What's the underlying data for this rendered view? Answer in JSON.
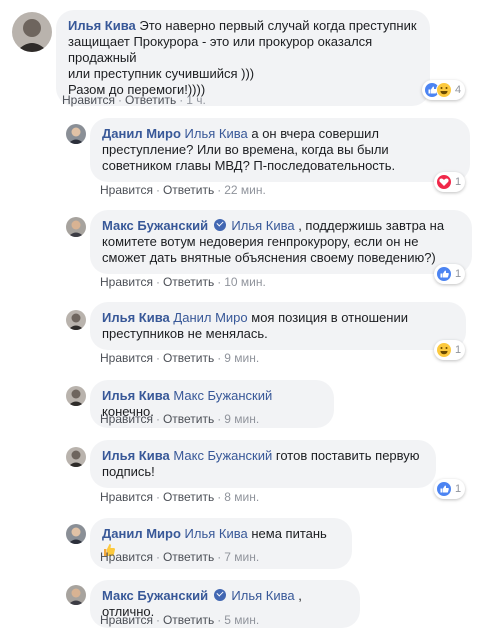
{
  "comments": [
    {
      "author": "Илья Кива",
      "body_lines": [
        "Это наверно первый случай когда преступник",
        "защищает Прокурора - это или прокурор оказался продажный",
        "или преступник сучившийся )))",
        "Разом до перемоги!)))) "
      ],
      "like_label": "Нравится",
      "reply_label": "Ответить",
      "time": "1 ч.",
      "reactions": [
        "like",
        "haha"
      ],
      "reaction_count": "4"
    },
    {
      "author": "Данил Миро",
      "mention": "Илья Кива",
      "body_lines": [
        " а он вчера совершил",
        "преступление? Или во времена, когда вы были",
        "советником главы МВД? П-последовательность."
      ],
      "like_label": "Нравится",
      "reply_label": "Ответить",
      "time": "22 мин.",
      "reactions": [
        "love"
      ],
      "reaction_count": "1"
    },
    {
      "author": "Макс Бужанский",
      "mention": "Илья Кива",
      "body_lines": [
        " , поддержишь завтра на",
        "комитете вотум недоверия генпрокурору, если он не",
        "сможет дать внятные объяснения своему поведению?)"
      ],
      "like_label": "Нравится",
      "reply_label": "Ответить",
      "time": "10 мин.",
      "reactions": [
        "like"
      ],
      "reaction_count": "1"
    },
    {
      "author": "Илья Кива",
      "mention": "Данил Миро",
      "body_lines": [
        " моя позиция в отношении",
        "преступников не менялась."
      ],
      "like_label": "Нравится",
      "reply_label": "Ответить",
      "time": "9 мин.",
      "reactions": [
        "haha"
      ],
      "reaction_count": "1"
    },
    {
      "author": "Илья Кива",
      "mention": "Макс Бужанский",
      "body_lines": [
        " конечно."
      ],
      "like_label": "Нравится",
      "reply_label": "Ответить",
      "time": "9 мин."
    },
    {
      "author": "Илья Кива",
      "mention": "Макс Бужанский",
      "body_lines": [
        " готов поставить первую",
        "подпись!"
      ],
      "like_label": "Нравится",
      "reply_label": "Ответить",
      "time": "8 мин.",
      "reactions": [
        "like"
      ],
      "reaction_count": "1"
    },
    {
      "author": "Данил Миро",
      "mention": "Илья Кива",
      "body_lines": [
        " нема питань "
      ],
      "like_label": "Нравится",
      "reply_label": "Ответить",
      "time": "7 мин."
    },
    {
      "author": "Макс Бужанский",
      "mention": "Илья Кива",
      "body_lines": [
        " , отлично."
      ],
      "like_label": "Нравится",
      "reply_label": "Ответить",
      "time": "5 мин."
    }
  ],
  "colors": {
    "name": "#385898",
    "bubble": "#f2f3f5",
    "meta": "#90949c",
    "like": "#4c84f2",
    "love": "#f0284a",
    "haha": "#fcc93e"
  },
  "icons": {
    "verified": "verified-badge-icon",
    "thumbs_up_emoji": "thumbs-up-emoji-icon"
  }
}
